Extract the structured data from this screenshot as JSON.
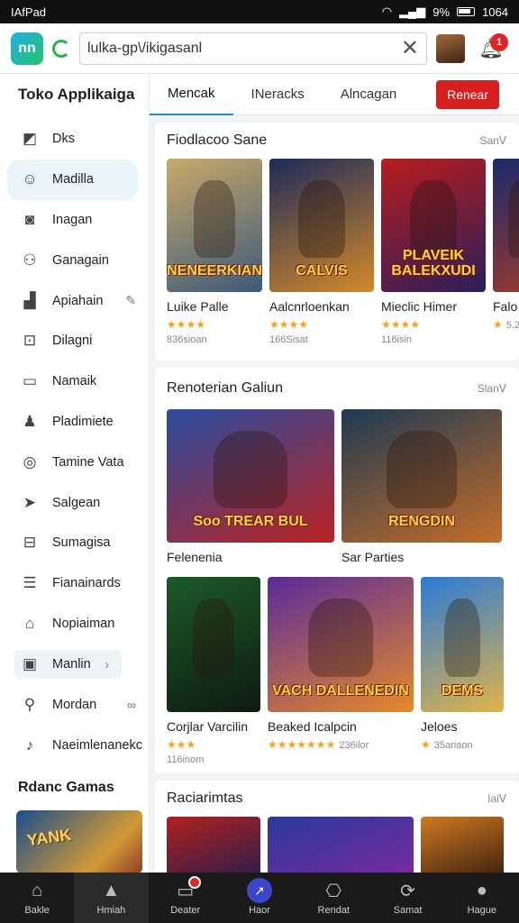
{
  "status": {
    "left": "IAfPad ",
    "pct": "9%",
    "time": "1064"
  },
  "topbar": {
    "logo": "nn",
    "url": "lulka-gp\\/ikigasanl",
    "badge": "1"
  },
  "sidebar": {
    "title": "Toko Applikaiga",
    "items": [
      {
        "label": "Dks",
        "icon": "briefcase-icon",
        "glyph": "◩"
      },
      {
        "label": "Madilla",
        "icon": "chat-icon",
        "glyph": "☺",
        "active": true
      },
      {
        "label": "Inagan",
        "icon": "camera-icon",
        "glyph": "◙"
      },
      {
        "label": "Ganagain",
        "icon": "gamepad-icon",
        "glyph": "⚇"
      },
      {
        "label": "Apiahain",
        "icon": "bag-icon",
        "glyph": "▟",
        "trail": "✎"
      },
      {
        "label": "Dilagni",
        "icon": "lock-icon",
        "glyph": "⊡"
      },
      {
        "label": "Namaik",
        "icon": "folder-icon",
        "glyph": "▭"
      },
      {
        "label": "Pladimiete",
        "icon": "person-icon",
        "glyph": "♟"
      },
      {
        "label": "Tamine Vata",
        "icon": "swirl-icon",
        "glyph": "◎"
      },
      {
        "label": "Salgean",
        "icon": "send-icon",
        "glyph": "➤"
      },
      {
        "label": "Sumagisa",
        "icon": "window-icon",
        "glyph": "⊟"
      },
      {
        "label": "Fianainards",
        "icon": "tools-icon",
        "glyph": "☰"
      },
      {
        "label": "Nopiaiman",
        "icon": "home-icon",
        "glyph": "⌂"
      },
      {
        "label": "Manlin",
        "icon": "calendar-icon",
        "glyph": "▣",
        "framed": true,
        "trail": "›"
      },
      {
        "label": "Mordan",
        "icon": "search-icon",
        "glyph": "⚲",
        "trail": "∞"
      },
      {
        "label": "Naeimlenanekc",
        "icon": "music-icon",
        "glyph": "♪"
      }
    ],
    "recent_title": "Rdanc Gamas",
    "recent_art": "YANK"
  },
  "tabs": {
    "items": [
      "Mencak",
      "INeracks",
      "Alncagan"
    ],
    "button": "Renear"
  },
  "section1": {
    "title": "Fiodlacoo Sane",
    "more": "Sanᐯ",
    "cards": [
      {
        "name": "Luike Palle",
        "stars": "★★★★",
        "sub": "836sioan",
        "art": "NENEERKIAN",
        "c1": "#c9a96a",
        "c2": "#3d5a7a"
      },
      {
        "name": "Aalcnrloenkan",
        "stars": "★★★★",
        "sub": "166Sisat",
        "art": "CALVIS",
        "c1": "#1e2a5a",
        "c2": "#d18a2a"
      },
      {
        "name": "Mieclic Himer",
        "stars": "★★★★",
        "sub": "116isin",
        "art": "PLAVEIK BALEKXUDI",
        "c1": "#b81d1d",
        "c2": "#2b1e5a"
      },
      {
        "name": "Falo",
        "stars": "★",
        "sub": "",
        "rv": "5.2",
        "art": "",
        "c1": "#1a2a6a",
        "c2": "#9a3a30"
      }
    ]
  },
  "section2": {
    "title": "Renoterian Galiun",
    "more": "Slanᐯ",
    "big": [
      {
        "name": "Felenenia",
        "art": "Soo TREAR BUL",
        "c1": "#2a4da0",
        "c2": "#b92222"
      },
      {
        "name": "Sar Parties",
        "art": "RENGDIN",
        "c1": "#1d3a52",
        "c2": "#c46d2a"
      }
    ],
    "small": [
      {
        "name": "Corjlar Varcilin",
        "stars": "★★★",
        "sub": "116inom",
        "art": "",
        "c1": "#1c5a2a",
        "c2": "#0e1a0e"
      },
      {
        "name": "Beaked Icalpcin",
        "stars": "★★★★★★★",
        "rv": "236ilor",
        "art": "VACH DALLENEDIN",
        "c1": "#5a2a9a",
        "c2": "#e68a2a"
      },
      {
        "name": "Jeloes",
        "stars": "★",
        "rv": "35ariaon",
        "art": "DEMS",
        "c1": "#2a7ad6",
        "c2": "#e0b44a"
      }
    ]
  },
  "section3": {
    "title": "Raciarimtas",
    "more": "Iaiᐯ"
  },
  "bottomnav": [
    {
      "label": "Bakle",
      "glyph": "⌂",
      "icon": "home-icon"
    },
    {
      "label": "Hmiah",
      "glyph": "▲",
      "icon": "store-icon",
      "active": true
    },
    {
      "label": "Deater",
      "glyph": "▭",
      "icon": "chat-icon",
      "dot": true
    },
    {
      "label": "Haor",
      "glyph": "↗",
      "icon": "discover-icon",
      "circle": true
    },
    {
      "label": "Rendat",
      "glyph": "⎔",
      "icon": "game-icon"
    },
    {
      "label": "Samat",
      "glyph": "⟳",
      "icon": "refresh-icon"
    },
    {
      "label": "Hague",
      "glyph": "●",
      "icon": "profile-icon"
    }
  ]
}
